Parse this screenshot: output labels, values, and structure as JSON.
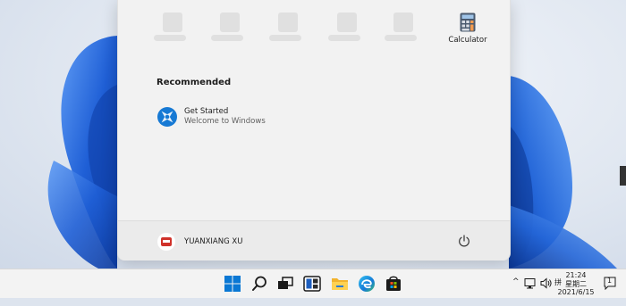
{
  "start_menu": {
    "pinned": [
      {
        "placeholder": true
      },
      {
        "placeholder": true
      },
      {
        "placeholder": true
      },
      {
        "placeholder": true
      },
      {
        "placeholder": true
      },
      {
        "label": "Calculator",
        "icon": "calculator-icon"
      }
    ],
    "recommended_title": "Recommended",
    "recommended": [
      {
        "name": "Get Started",
        "subtitle": "Welcome to Windows",
        "icon": "get-started-icon"
      }
    ],
    "user_name": "YUANXIANG XU",
    "power_icon": "power-icon"
  },
  "taskbar": {
    "icons": [
      "start-icon",
      "search-icon",
      "task-view-icon",
      "widgets-icon",
      "file-explorer-icon",
      "edge-icon",
      "store-icon"
    ],
    "tray": {
      "ime": "拼",
      "time": "21:24",
      "day": "星期二",
      "date": "2021/6/15",
      "notification_count": "1"
    }
  },
  "colors": {
    "accent": "#0067c0",
    "wallpaper_blue": "#1f5fd6",
    "taskbar": "#f3f3f3",
    "menu": "#f2f2f2"
  }
}
